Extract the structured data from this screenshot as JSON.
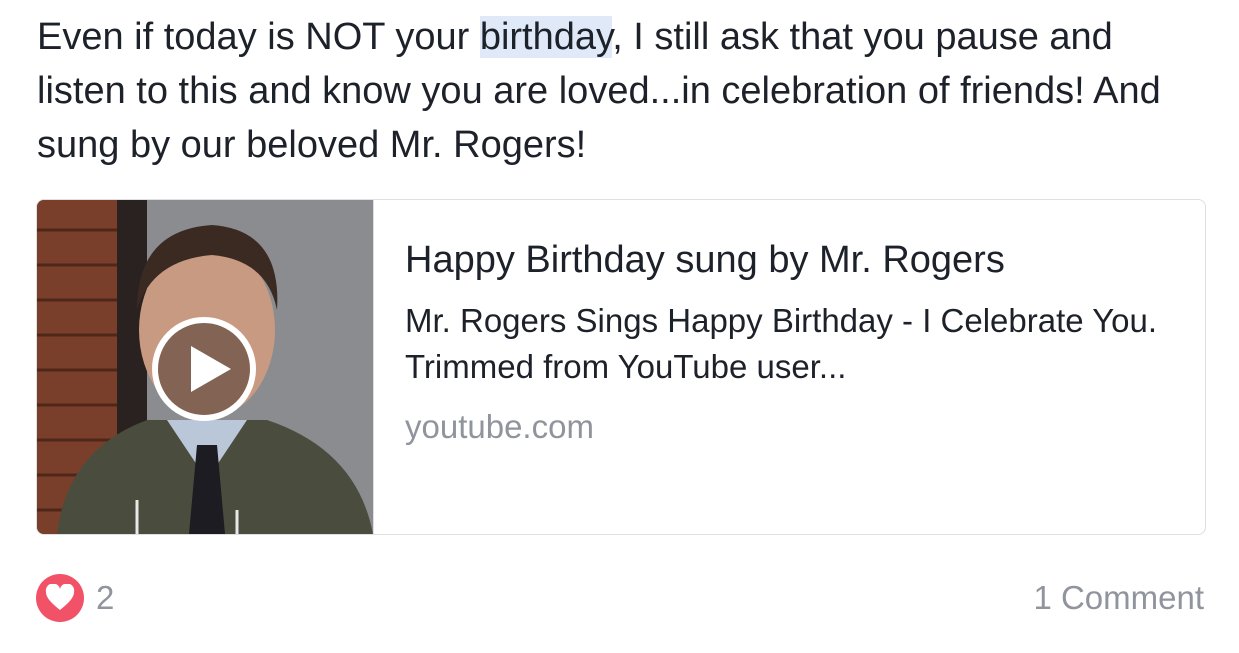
{
  "post": {
    "text_before": "Even if today is NOT your ",
    "text_highlight": "birthday",
    "text_after": ", I still ask that you pause and listen to this and know you are loved...in celebration of friends! And sung by our beloved Mr. Rogers!"
  },
  "link_card": {
    "title": "Happy Birthday sung by Mr. Rogers",
    "description": "Mr. Rogers Sings Happy Birthday - I Celebrate You. Trimmed from YouTube user...",
    "domain": "youtube.com",
    "thumbnail_icon": "video-thumbnail",
    "play_icon": "play-icon"
  },
  "footer": {
    "reaction_icon": "heart-icon",
    "reaction_color": "#f25268",
    "reaction_count": "2",
    "comment_count": "1 Comment"
  },
  "colors": {
    "text": "#1d2129",
    "muted": "#90949c",
    "highlight": "#dfe9f7",
    "border": "#dddfe2"
  }
}
